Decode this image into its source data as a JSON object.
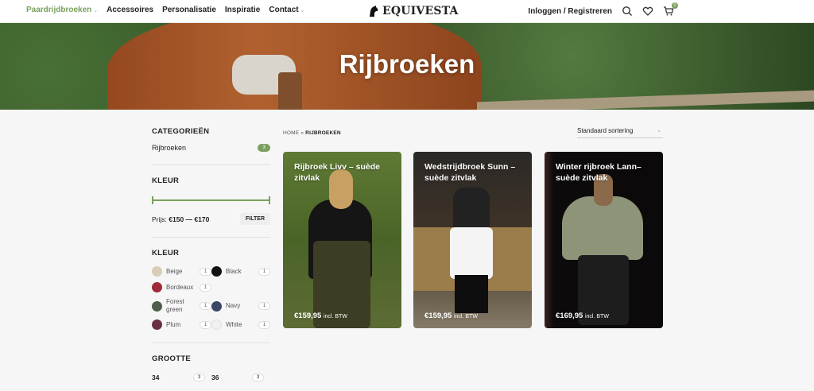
{
  "nav": {
    "items": [
      {
        "label": "Paardrijdbroeken",
        "has_dropdown": true,
        "active": true
      },
      {
        "label": "Accessoires",
        "has_dropdown": false
      },
      {
        "label": "Personalisatie",
        "has_dropdown": false
      },
      {
        "label": "Inspiratie",
        "has_dropdown": false
      },
      {
        "label": "Contact",
        "has_dropdown": true
      }
    ],
    "brand": "EQUIVESTA",
    "account_label": "Inloggen / Registreren",
    "cart_count": "0",
    "icons": [
      "search-icon",
      "heart-icon",
      "cart-icon"
    ]
  },
  "hero": {
    "title": "Rijbroeken"
  },
  "sidebar": {
    "categories": {
      "title": "CATEGORIEËN",
      "items": [
        {
          "label": "Rijbroeken",
          "count": "3"
        }
      ]
    },
    "price": {
      "title": "KLEUR",
      "label": "Prijs:",
      "range": "€150 — €170",
      "filter_label": "FILTER"
    },
    "colors": {
      "title": "KLEUR",
      "items": [
        {
          "label": "Beige",
          "count": "1",
          "color": "#d9cdb8"
        },
        {
          "label": "Black",
          "count": "1",
          "color": "#111111"
        },
        {
          "label": "Bordeaux",
          "count": "1",
          "color": "#9e2b3a"
        },
        {
          "label": "Forest green",
          "count": "1",
          "color": "#4d5e4c"
        },
        {
          "label": "Navy",
          "count": "1",
          "color": "#3b4566"
        },
        {
          "label": "Plum",
          "count": "1",
          "color": "#6b2f45"
        },
        {
          "label": "White",
          "count": "1",
          "color": "#f1f1f1"
        }
      ]
    },
    "sizes": {
      "title": "GROOTTE",
      "items": [
        {
          "label": "34",
          "count": "3"
        },
        {
          "label": "36",
          "count": "3"
        }
      ]
    }
  },
  "breadcrumb": {
    "home": "HOME",
    "separator": "»",
    "current": "RIJBROEKEN"
  },
  "sort": {
    "selected": "Standaard sortering"
  },
  "products": [
    {
      "title": "Rijbroek Livv – suède zitvlak",
      "price": "€159,95",
      "tax": "incl. BTW",
      "bg": "#566b2d"
    },
    {
      "title": "Wedstrijdbroek Sunn – suède zitvlak",
      "price": "€159,95",
      "tax": "incl. BTW",
      "bg": "#2c2a28"
    },
    {
      "title": "Winter rijbroek Lann– suède zitvlak",
      "price": "€169,95",
      "tax": "incl. BTW",
      "bg": "#0d0b0b"
    }
  ],
  "colors": {
    "accent": "#7aa05e"
  }
}
